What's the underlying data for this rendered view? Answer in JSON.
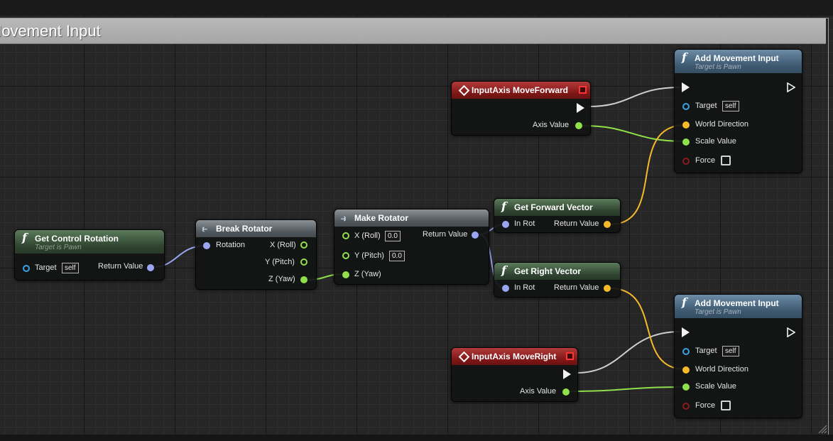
{
  "comment": {
    "title": "Movement Input"
  },
  "nodes": {
    "get_control_rotation": {
      "title": "Get Control Rotation",
      "subtitle": "Target is Pawn",
      "target_label": "Target",
      "target_value": "self",
      "return_label": "Return Value"
    },
    "break_rotator": {
      "title": "Break Rotator",
      "rotation_label": "Rotation",
      "x_label": "X (Roll)",
      "y_label": "Y (Pitch)",
      "z_label": "Z (Yaw)"
    },
    "make_rotator": {
      "title": "Make Rotator",
      "x_label": "X (Roll)",
      "x_value": "0.0",
      "y_label": "Y (Pitch)",
      "y_value": "0.0",
      "z_label": "Z (Yaw)",
      "return_label": "Return Value"
    },
    "get_forward_vector": {
      "title": "Get Forward Vector",
      "in_label": "In Rot",
      "return_label": "Return Value"
    },
    "get_right_vector": {
      "title": "Get Right Vector",
      "in_label": "In Rot",
      "return_label": "Return Value"
    },
    "input_move_forward": {
      "title": "InputAxis MoveForward",
      "axis_label": "Axis Value"
    },
    "input_move_right": {
      "title": "InputAxis MoveRight",
      "axis_label": "Axis Value"
    },
    "add_movement_input_1": {
      "title": "Add Movement Input",
      "subtitle": "Target is Pawn",
      "target_label": "Target",
      "target_value": "self",
      "world_dir_label": "World Direction",
      "scale_label": "Scale Value",
      "force_label": "Force"
    },
    "add_movement_input_2": {
      "title": "Add Movement Input",
      "subtitle": "Target is Pawn",
      "target_label": "Target",
      "target_value": "self",
      "world_dir_label": "World Direction",
      "scale_label": "Scale Value",
      "force_label": "Force"
    }
  },
  "colors": {
    "exec_wire": "#cfcfcf",
    "float_wire": "#8fe04a",
    "vector_wire": "#f5b92a",
    "rotator_wire": "#9aa6f2",
    "function_header": "#2f4330",
    "target_header": "#3d5870",
    "event_header": "#7e1616"
  },
  "icons": {
    "function": "function-icon",
    "event": "event-diamond-icon",
    "break": "break-struct-icon",
    "make": "make-struct-icon",
    "exec": "exec-pin-icon"
  }
}
